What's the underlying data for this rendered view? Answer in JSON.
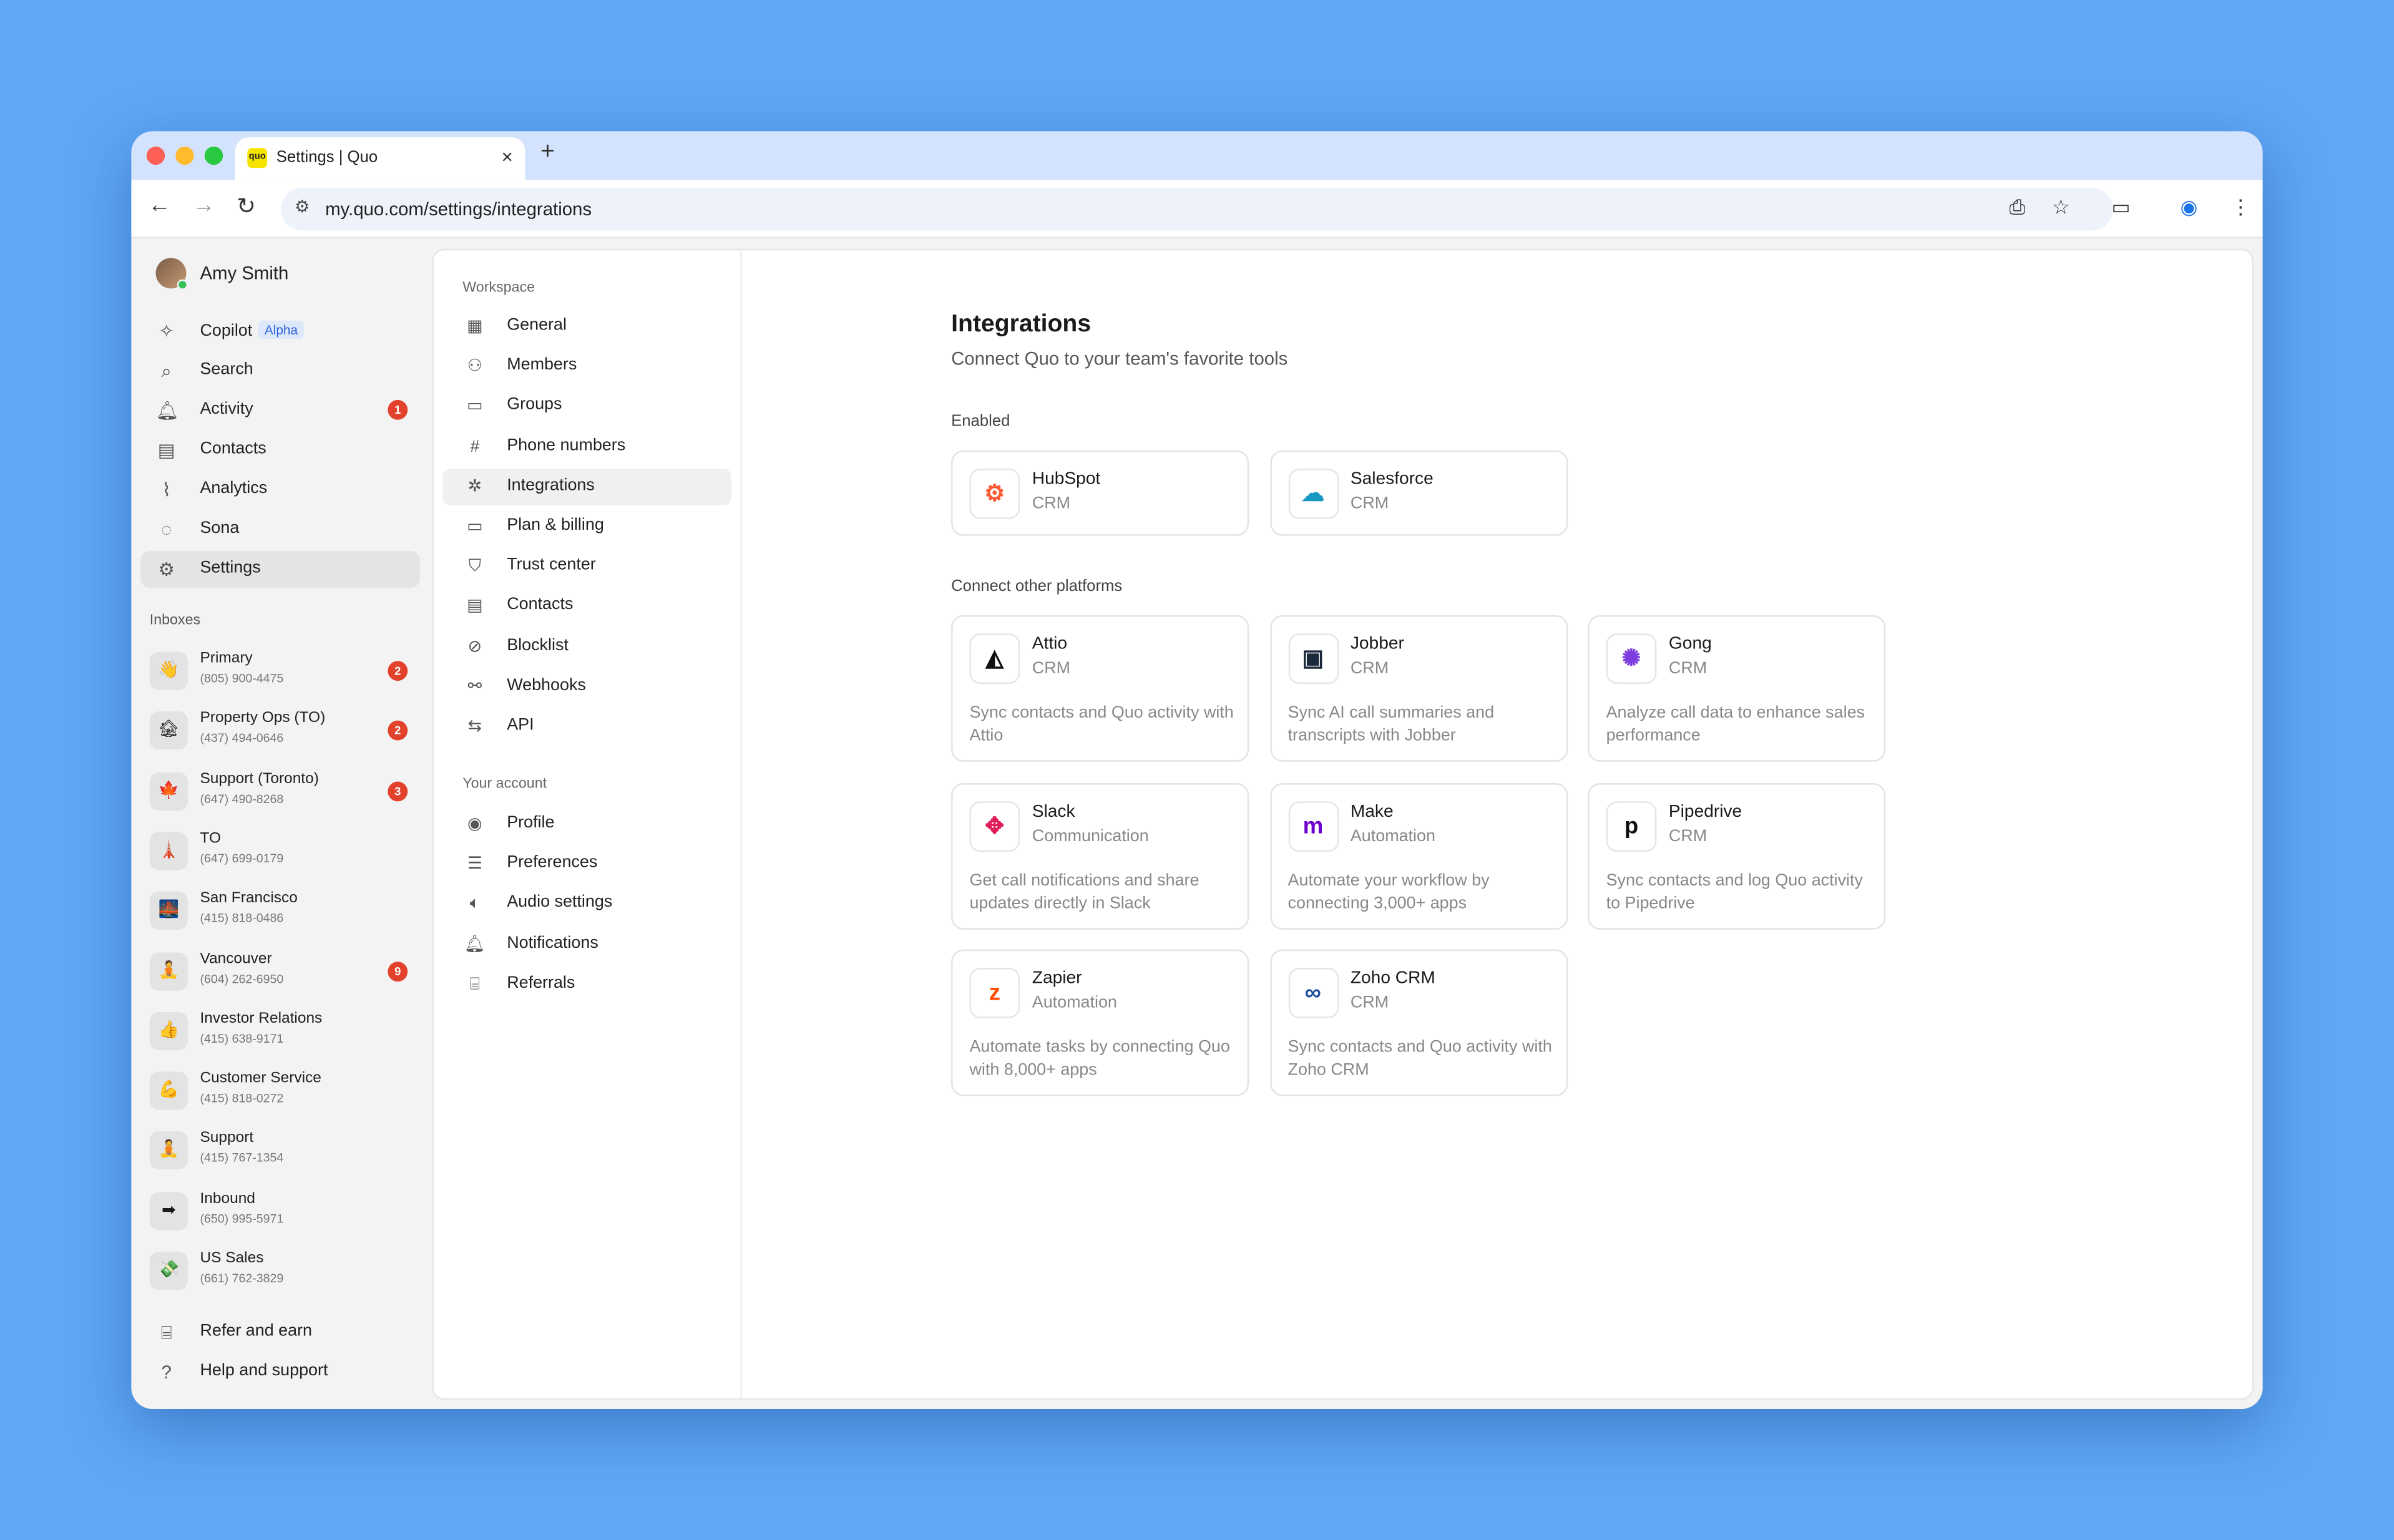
{
  "browser": {
    "tab_title": "Settings | Quo",
    "favicon_text": "quo",
    "url": "my.quo.com/settings/integrations",
    "icons": [
      "back-icon",
      "forward-icon",
      "reload-icon",
      "site-settings-icon",
      "install-icon",
      "star-icon",
      "media-icon",
      "profile-icon",
      "menu-icon"
    ]
  },
  "sidebar": {
    "user_name": "Amy Smith",
    "nav": [
      {
        "label": "Copilot",
        "pill": "Alpha",
        "icon": "sparkle-icon",
        "glyph": "✧"
      },
      {
        "label": "Search",
        "icon": "search-icon",
        "glyph": "⌕"
      },
      {
        "label": "Activity",
        "badge": "1",
        "icon": "bell-icon",
        "glyph": "🔔︎"
      },
      {
        "label": "Contacts",
        "icon": "contacts-icon",
        "glyph": "▤"
      },
      {
        "label": "Analytics",
        "icon": "analytics-icon",
        "glyph": "⌇"
      },
      {
        "label": "Sona",
        "icon": "sona-icon",
        "glyph": "◌"
      },
      {
        "label": "Settings",
        "icon": "gear-icon",
        "glyph": "⚙"
      }
    ],
    "inboxes_heading": "Inboxes",
    "inboxes": [
      {
        "name": "Primary",
        "phone": "(805) 900-4475",
        "badge": "2",
        "emoji": "👋"
      },
      {
        "name": "Property Ops (TO)",
        "phone": "(437) 494-0646",
        "badge": "2",
        "emoji": "🏚"
      },
      {
        "name": "Support (Toronto)",
        "phone": "(647) 490-8268",
        "badge": "3",
        "emoji": "🍁"
      },
      {
        "name": "TO",
        "phone": "(647) 699-0179",
        "badge": "",
        "emoji": "🗼"
      },
      {
        "name": "San Francisco",
        "phone": "(415) 818-0486",
        "badge": "",
        "emoji": "🌉"
      },
      {
        "name": "Vancouver",
        "phone": "(604) 262-6950",
        "badge": "9",
        "emoji": "🧘"
      },
      {
        "name": "Investor Relations",
        "phone": "(415) 638-9171",
        "badge": "",
        "emoji": "👍"
      },
      {
        "name": "Customer Service",
        "phone": "(415) 818-0272",
        "badge": "",
        "emoji": "💪"
      },
      {
        "name": "Support",
        "phone": "(415) 767-1354",
        "badge": "",
        "emoji": "🧘"
      },
      {
        "name": "Inbound",
        "phone": "(650) 995-5971",
        "badge": "",
        "emoji": "➡"
      },
      {
        "name": "US Sales",
        "phone": "(661) 762-3829",
        "badge": "",
        "emoji": "💸"
      }
    ],
    "footer": [
      {
        "label": "Refer and earn",
        "icon": "gift-icon",
        "glyph": "⌸"
      },
      {
        "label": "Help and support",
        "icon": "help-icon",
        "glyph": "?"
      }
    ]
  },
  "settings_nav": {
    "workspace_heading": "Workspace",
    "workspace": [
      {
        "label": "General",
        "icon": "building-icon",
        "glyph": "▦"
      },
      {
        "label": "Members",
        "icon": "members-icon",
        "glyph": "⚇"
      },
      {
        "label": "Groups",
        "icon": "folder-icon",
        "glyph": "▭"
      },
      {
        "label": "Phone numbers",
        "icon": "hash-icon",
        "glyph": "#"
      },
      {
        "label": "Integrations",
        "icon": "integrations-icon",
        "glyph": "✲"
      },
      {
        "label": "Plan & billing",
        "icon": "card-icon",
        "glyph": "▭"
      },
      {
        "label": "Trust center",
        "icon": "shield-icon",
        "glyph": "⛉"
      },
      {
        "label": "Contacts",
        "icon": "contacts-icon",
        "glyph": "▤"
      },
      {
        "label": "Blocklist",
        "icon": "block-icon",
        "glyph": "⊘"
      },
      {
        "label": "Webhooks",
        "icon": "webhook-icon",
        "glyph": "⚯"
      },
      {
        "label": "API",
        "icon": "api-icon",
        "glyph": "⇆"
      }
    ],
    "account_heading": "Your account",
    "account": [
      {
        "label": "Profile",
        "icon": "profile-icon",
        "glyph": "◉"
      },
      {
        "label": "Preferences",
        "icon": "sliders-icon",
        "glyph": "☰"
      },
      {
        "label": "Audio settings",
        "icon": "speaker-icon",
        "glyph": "🔈︎"
      },
      {
        "label": "Notifications",
        "icon": "bell-icon",
        "glyph": "🔔︎"
      },
      {
        "label": "Referrals",
        "icon": "gift-icon",
        "glyph": "⌸"
      }
    ]
  },
  "main": {
    "title": "Integrations",
    "subtitle": "Connect Quo to your team's favorite tools",
    "enabled_heading": "Enabled",
    "enabled": [
      {
        "name": "HubSpot",
        "category": "CRM",
        "icon": "hubspot-icon",
        "glyph": "⚙",
        "color": "#ff5c35"
      },
      {
        "name": "Salesforce",
        "category": "CRM",
        "icon": "salesforce-icon",
        "glyph": "☁",
        "color": "#1798c1"
      }
    ],
    "other_heading": "Connect other platforms",
    "others": [
      {
        "name": "Attio",
        "category": "CRM",
        "desc": "Sync contacts and Quo activity with Attio",
        "icon": "attio-icon",
        "glyph": "◭",
        "color": "#111111"
      },
      {
        "name": "Jobber",
        "category": "CRM",
        "desc": "Sync AI call summaries and transcripts with Jobber",
        "icon": "jobber-icon",
        "glyph": "▣",
        "color": "#1b2a3a"
      },
      {
        "name": "Gong",
        "category": "CRM",
        "desc": "Analyze call data to enhance sales performance",
        "icon": "gong-icon",
        "glyph": "✺",
        "color": "#7d3de0"
      },
      {
        "name": "Slack",
        "category": "Communication",
        "desc": "Get call notifications and share updates directly in Slack",
        "icon": "slack-icon",
        "glyph": "✥",
        "color": "#e01e5a"
      },
      {
        "name": "Make",
        "category": "Automation",
        "desc": "Automate your workflow by connecting 3,000+ apps",
        "icon": "make-icon",
        "glyph": "m",
        "color": "#6d00cc"
      },
      {
        "name": "Pipedrive",
        "category": "CRM",
        "desc": "Sync contacts and log Quo activity to Pipedrive",
        "icon": "pipedrive-icon",
        "glyph": "p",
        "color": "#111111"
      },
      {
        "name": "Zapier",
        "category": "Automation",
        "desc": "Automate tasks by connecting Quo with 8,000+ apps",
        "icon": "zapier-icon",
        "glyph": "z",
        "color": "#ff4a00"
      },
      {
        "name": "Zoho CRM",
        "category": "CRM",
        "desc": "Sync contacts and Quo activity with Zoho CRM",
        "icon": "zoho-icon",
        "glyph": "∞",
        "color": "#1f4e9c"
      }
    ]
  }
}
